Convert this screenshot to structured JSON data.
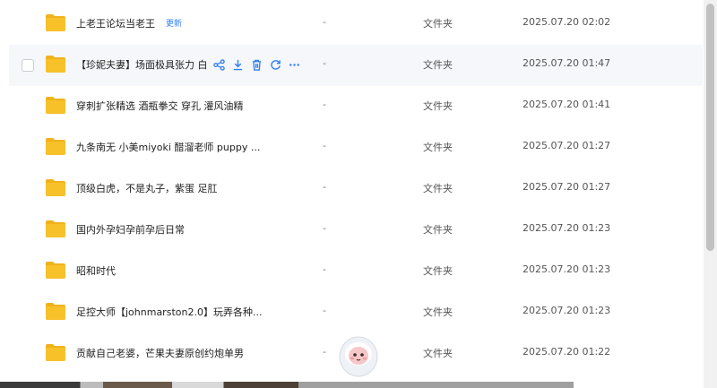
{
  "rows": [
    {
      "name": "上老王论坛当老王",
      "badge": "更新",
      "size": "-",
      "type": "文件夹",
      "date": "2025.07.20 02:02"
    },
    {
      "name": "【珍妮夫妻】场面极具张力 白",
      "size": "-",
      "type": "文件夹",
      "date": "2025.07.20 01:47",
      "hover": true,
      "actions": [
        "share-icon",
        "download-icon",
        "delete-icon",
        "refresh-icon",
        "more-icon"
      ]
    },
    {
      "name": "穿刺扩张精选 酒瓶拳交 穿孔 灌风油精",
      "size": "-",
      "type": "文件夹",
      "date": "2025.07.20 01:41"
    },
    {
      "name": "九条南无 小美miyoki 醋溜老师 puppy ...",
      "size": "-",
      "type": "文件夹",
      "date": "2025.07.20 01:27"
    },
    {
      "name": "顶级白虎，不是丸子，紫蛋 足肛",
      "size": "-",
      "type": "文件夹",
      "date": "2025.07.20 01:27"
    },
    {
      "name": "国内外孕妇孕前孕后日常",
      "size": "-",
      "type": "文件夹",
      "date": "2025.07.20 01:23"
    },
    {
      "name": "昭和时代",
      "size": "-",
      "type": "文件夹",
      "date": "2025.07.20 01:23"
    },
    {
      "name": "足控大师【johnmarston2.0】玩弄各种...",
      "size": "-",
      "type": "文件夹",
      "date": "2025.07.20 01:23"
    },
    {
      "name": "贡献自己老婆，芒果夫妻原创约炮单男",
      "size": "-",
      "type": "文件夹",
      "date": "2025.07.20 01:22"
    }
  ],
  "colors": {
    "folder": "#f7c12a",
    "folder_tab": "#f0b21c",
    "accent": "#2e7ef3",
    "hover_bg": "#f5f7fb"
  }
}
